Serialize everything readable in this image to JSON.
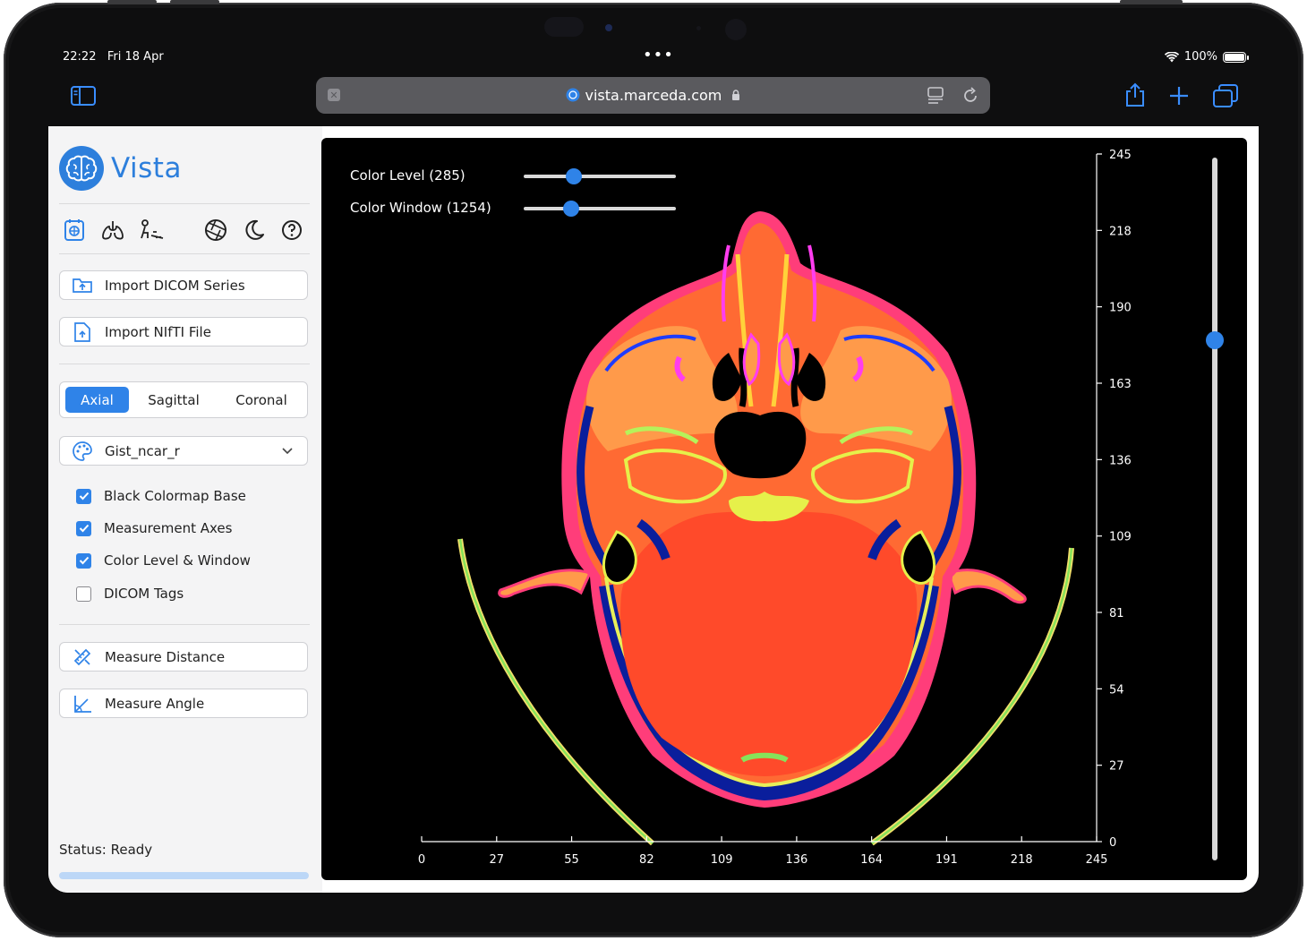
{
  "statusbar": {
    "time": "22:22",
    "date": "Fri 18 Apr",
    "dots": "•••",
    "battery": "100%"
  },
  "browser": {
    "url": "vista.marceda.com"
  },
  "app": {
    "name": "Vista",
    "tools": [
      "mri-scan-icon",
      "lungs-icon",
      "skeleton-icon",
      "aperture-icon",
      "moon-icon",
      "help-icon"
    ],
    "import_dicom": "Import DICOM Series",
    "import_nifti": "Import NIfTI File",
    "views": [
      "Axial",
      "Sagittal",
      "Coronal"
    ],
    "active_view": "Axial",
    "colormap": "Gist_ncar_r",
    "checkboxes": [
      {
        "label": "Black Colormap Base",
        "checked": true
      },
      {
        "label": "Measurement Axes",
        "checked": true
      },
      {
        "label": "Color Level & Window",
        "checked": true
      },
      {
        "label": "DICOM Tags",
        "checked": false
      }
    ],
    "measure_distance": "Measure Distance",
    "measure_angle": "Measure Angle",
    "status": "Status: Ready",
    "progress": 0
  },
  "viewer": {
    "color_level_label": "Color Level (285)",
    "color_level_value": 0.33,
    "color_window_label": "Color Window (1254)",
    "color_window_value": 0.31,
    "slice_slider_value": 0.74,
    "y_axis_ticks": [
      "245",
      "218",
      "190",
      "163",
      "136",
      "109",
      "81",
      "54",
      "27",
      "0"
    ],
    "x_axis_ticks": [
      "0",
      "27",
      "55",
      "82",
      "109",
      "136",
      "164",
      "191",
      "218",
      "245"
    ]
  }
}
